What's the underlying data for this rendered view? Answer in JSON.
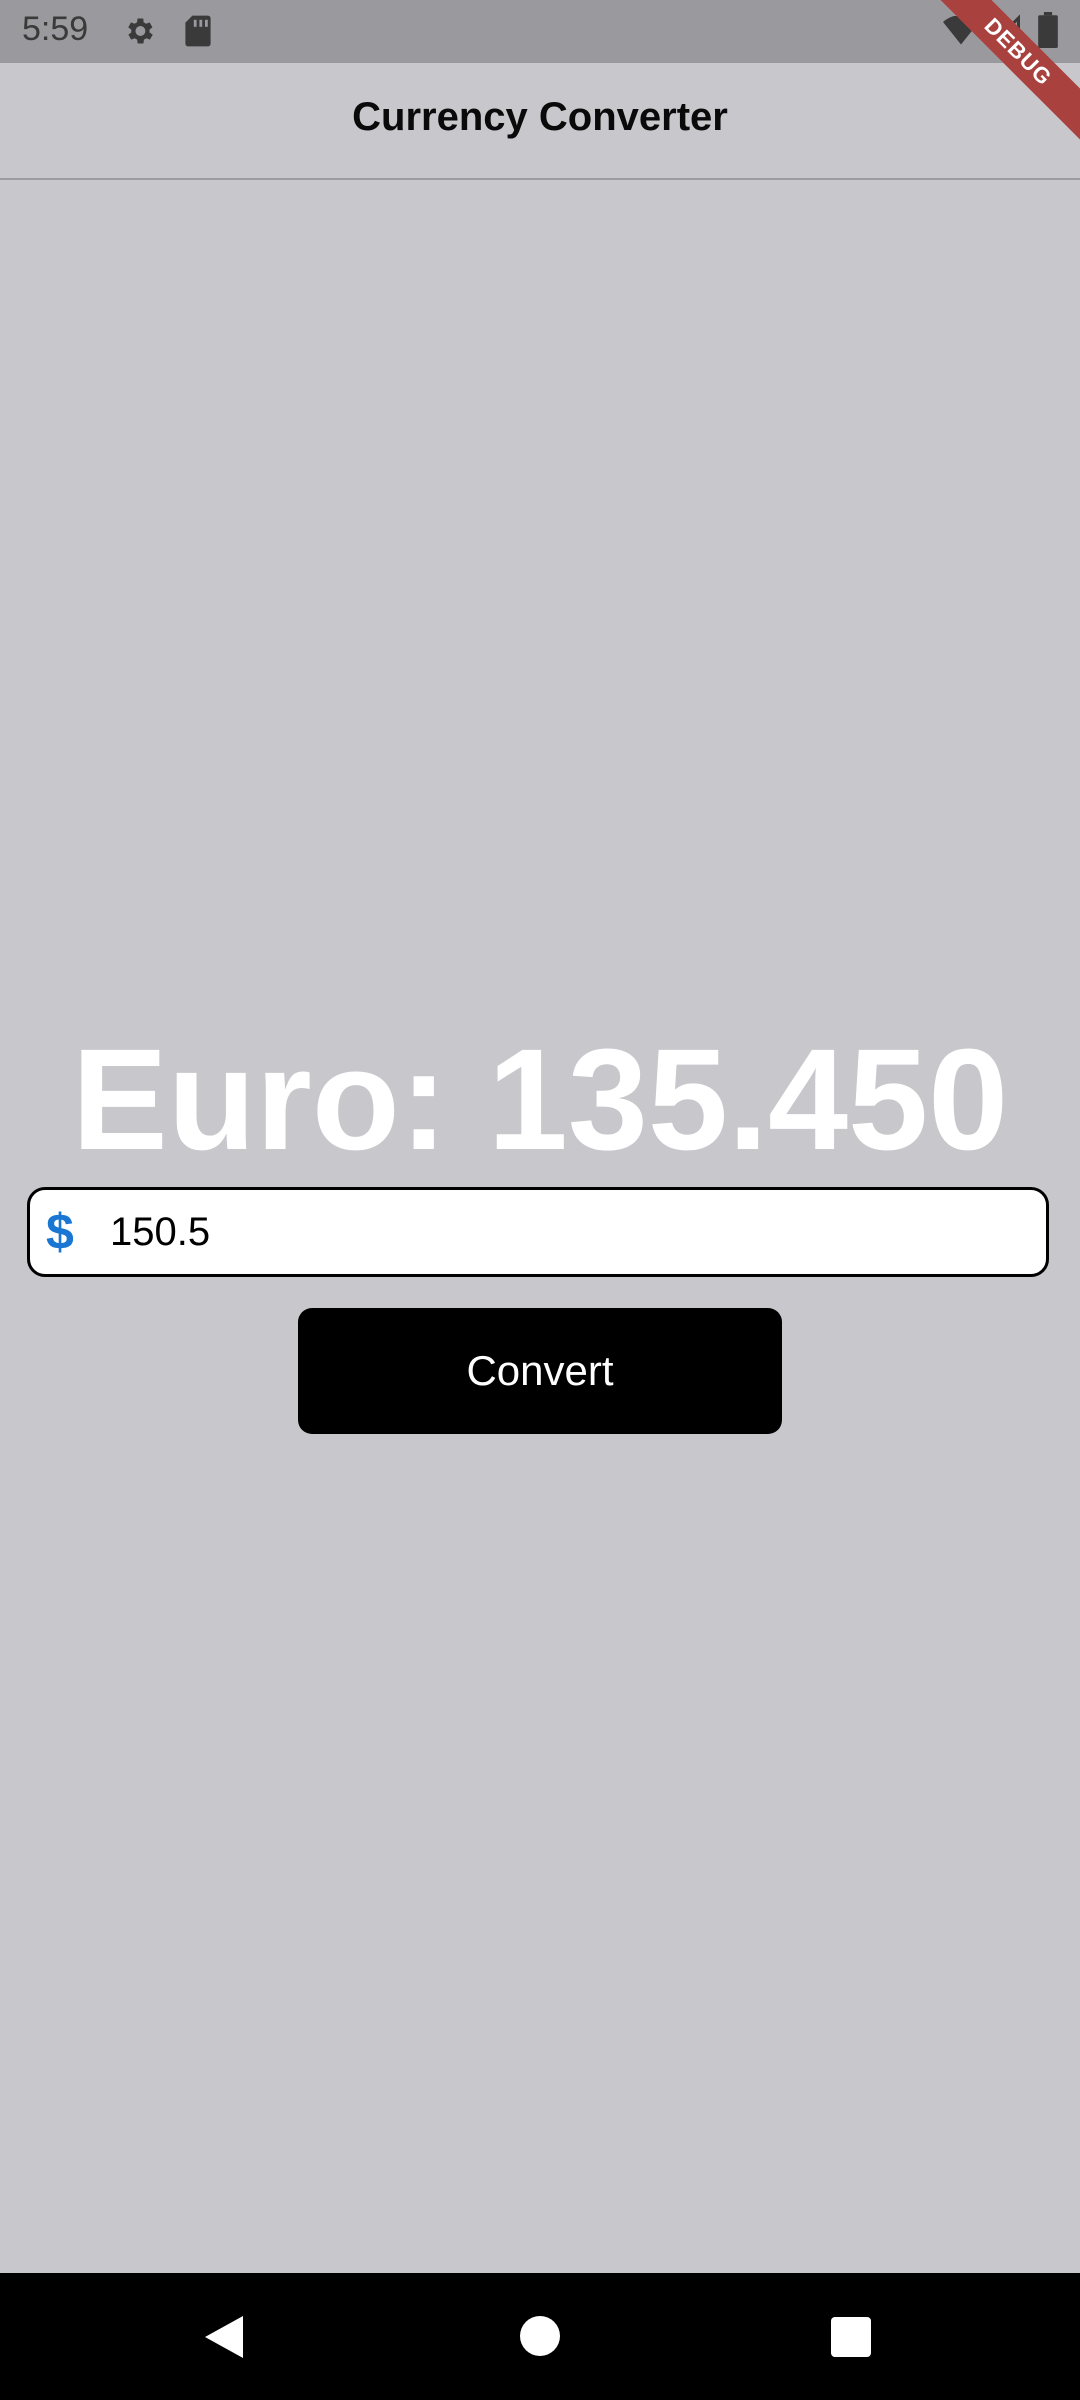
{
  "status_bar": {
    "time": "5:59",
    "icons": [
      "gear-icon",
      "sd-card-icon",
      "wifi-icon",
      "signal-icon",
      "battery-icon"
    ]
  },
  "debug_banner": "DEBUG",
  "app_bar": {
    "title": "Currency Converter"
  },
  "result": {
    "text": "Euro: 135.450"
  },
  "amount_input": {
    "prefix_icon": "dollar-icon",
    "prefix_symbol": "$",
    "value": "150.5"
  },
  "convert_button": {
    "label": "Convert"
  },
  "nav_bar": {
    "icons": [
      "back-icon",
      "home-icon",
      "recents-icon"
    ]
  },
  "colors": {
    "background": "#c8c7cc",
    "status_bar": "#9a999e",
    "accent": "#1976d2",
    "button": "#000000",
    "result_text": "#ffffff",
    "debug_ribbon": "#a9423f"
  }
}
